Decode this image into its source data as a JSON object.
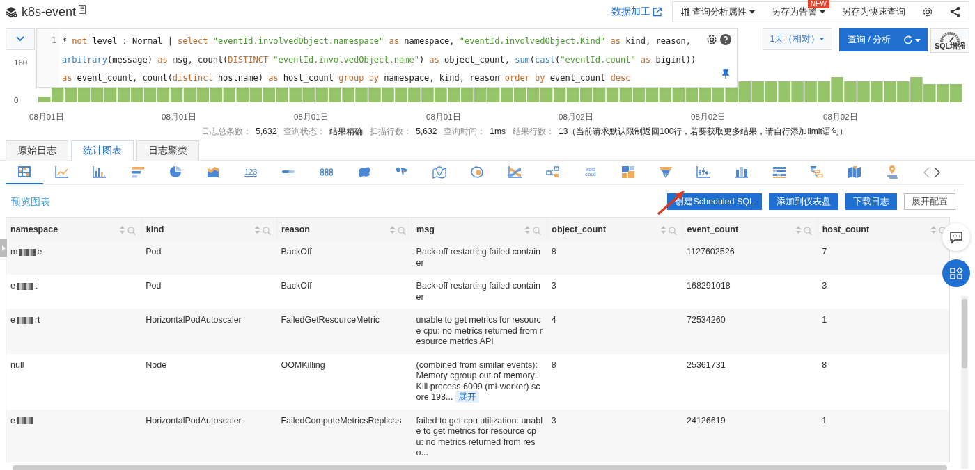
{
  "header": {
    "title": "k8s-event",
    "data_link": "数据加工",
    "toolbar": [
      {
        "kind": "sliders-dropdown",
        "label": "查询分析属性"
      },
      {
        "kind": "dropdown",
        "label": "另存为告警",
        "badge": "NEW"
      },
      {
        "kind": "plain",
        "label": "另存为快速查询"
      },
      {
        "kind": "gear"
      },
      {
        "kind": "share"
      }
    ]
  },
  "query": {
    "line_number": "1",
    "lines": [
      [
        {
          "kind": "plain",
          "text": "* "
        },
        {
          "kind": "keyword",
          "text": "not"
        },
        {
          "kind": "plain",
          "text": " level : Normal | "
        },
        {
          "kind": "keyword",
          "text": "select"
        },
        {
          "kind": "string",
          "text": " \"eventId.involvedObject.namespace\""
        },
        {
          "kind": "keyword",
          "text": " as"
        },
        {
          "kind": "plain",
          "text": " namespace, "
        },
        {
          "kind": "string",
          "text": "\"eventId.involvedObject.Kind\""
        },
        {
          "kind": "keyword",
          "text": " as"
        },
        {
          "kind": "plain",
          "text": " kind, reason,"
        }
      ],
      [
        {
          "kind": "function",
          "text": "arbitrary"
        },
        {
          "kind": "plain",
          "text": "(message) "
        },
        {
          "kind": "keyword",
          "text": "as"
        },
        {
          "kind": "plain",
          "text": " msg, count("
        },
        {
          "kind": "keyword",
          "text": "DISTINCT"
        },
        {
          "kind": "string",
          "text": " \"eventId.involvedObject.name\""
        },
        {
          "kind": "plain",
          "text": ") "
        },
        {
          "kind": "keyword",
          "text": "as"
        },
        {
          "kind": "plain",
          "text": " object_count, "
        },
        {
          "kind": "function",
          "text": "sum"
        },
        {
          "kind": "plain",
          "text": "("
        },
        {
          "kind": "function",
          "text": "cast"
        },
        {
          "kind": "plain",
          "text": "("
        },
        {
          "kind": "string",
          "text": "\"eventId.count\""
        },
        {
          "kind": "keyword",
          "text": " as"
        },
        {
          "kind": "plain",
          "text": " bigint))"
        }
      ],
      [
        {
          "kind": "keyword",
          "text": "as"
        },
        {
          "kind": "plain",
          "text": " event_count, count("
        },
        {
          "kind": "keyword",
          "text": "distinct"
        },
        {
          "kind": "plain",
          "text": " hostname) "
        },
        {
          "kind": "keyword",
          "text": "as"
        },
        {
          "kind": "plain",
          "text": " host_count "
        },
        {
          "kind": "keyword",
          "text": "group by"
        },
        {
          "kind": "plain",
          "text": " namespace, kind, reason "
        },
        {
          "kind": "keyword",
          "text": "order by"
        },
        {
          "kind": "plain",
          "text": " event_count "
        },
        {
          "kind": "keyword",
          "text": "desc"
        }
      ]
    ],
    "time_range": "1天（相对）",
    "search_button": "查询 / 分析",
    "sql_enhance": "SQL增强"
  },
  "histogram": {
    "y_labels": [
      "160",
      "0"
    ],
    "x_labels": [
      "08月01日",
      "08月01日",
      "08月01日",
      "08月01日",
      "08月02日",
      "08月02日",
      "08月02日"
    ]
  },
  "stats": [
    {
      "label": "日志总条数：",
      "value": "5,632"
    },
    {
      "label": "查询状态：",
      "value": "结果精确"
    },
    {
      "label": "扫描行数：",
      "value": "5,632"
    },
    {
      "label": "查询时间：",
      "value": "1ms"
    },
    {
      "label": "结果行数：",
      "value": "13（当前请求默认限制返回100行，若要获取更多结果，请自行添加limit语句）"
    }
  ],
  "tabs": [
    {
      "label": "原始日志",
      "selected": false
    },
    {
      "label": "统计图表",
      "selected": true
    },
    {
      "label": "日志聚类",
      "selected": false
    }
  ],
  "chart_types": [
    {
      "kind": "table",
      "selected": true
    },
    {
      "kind": "line",
      "selected": false
    },
    {
      "kind": "bar",
      "selected": false
    },
    {
      "kind": "hbar",
      "selected": false
    },
    {
      "kind": "pie",
      "selected": false
    },
    {
      "kind": "area",
      "selected": false
    },
    {
      "kind": "number",
      "label": "123",
      "selected": false
    },
    {
      "kind": "progress",
      "selected": false
    },
    {
      "kind": "dots",
      "selected": false
    },
    {
      "kind": "map",
      "selected": false
    },
    {
      "kind": "world",
      "selected": false
    },
    {
      "kind": "pin",
      "selected": false
    },
    {
      "kind": "bubble",
      "selected": false
    },
    {
      "kind": "sankey",
      "selected": false
    },
    {
      "kind": "graph",
      "selected": false
    },
    {
      "kind": "wordcloud",
      "label": "word cloud",
      "selected": false
    },
    {
      "kind": "treemap",
      "selected": false
    },
    {
      "kind": "funnel",
      "selected": false
    },
    {
      "kind": "box",
      "selected": false
    },
    {
      "kind": "columns",
      "selected": false
    },
    {
      "kind": "grid",
      "selected": false
    },
    {
      "kind": "gantt",
      "selected": false
    },
    {
      "kind": "foldmap",
      "selected": false
    },
    {
      "kind": "location",
      "selected": false
    }
  ],
  "preview": {
    "title": "预览图表",
    "actions": [
      {
        "label": "创建Scheduled SQL",
        "primary": true
      },
      {
        "label": "添加到仪表盘",
        "primary": true
      },
      {
        "label": "下载日志",
        "primary": true
      },
      {
        "label": "展开配置",
        "primary": false
      }
    ]
  },
  "table": {
    "columns": [
      "namespace",
      "kind",
      "reason",
      "msg",
      "object_count",
      "event_count",
      "host_count"
    ],
    "rows": [
      {
        "namespace": {
          "start": "m",
          "redacted": true,
          "end": "e"
        },
        "kind": "Pod",
        "reason": "BackOff",
        "msg": "Back-off restarting failed container",
        "object_count": "8",
        "event_count": "1127602526",
        "host_count": "7"
      },
      {
        "namespace": {
          "start": "e",
          "redacted": true,
          "end": "t"
        },
        "kind": "Pod",
        "reason": "BackOff",
        "msg": "Back-off restarting failed container",
        "object_count": "3",
        "event_count": "168291018",
        "host_count": "3"
      },
      {
        "namespace": {
          "start": "e",
          "redacted": true,
          "end": "rt"
        },
        "kind": "HorizontalPodAutoscaler",
        "reason": "FailedGetResourceMetric",
        "msg": "unable to get metrics for resource cpu: no metrics returned from resource metrics API",
        "object_count": "4",
        "event_count": "72534260",
        "host_count": "1"
      },
      {
        "namespace": {
          "start": "null",
          "redacted": false
        },
        "kind": "Node",
        "reason": "OOMKilling",
        "msg": "(combined from similar events): Memory cgroup out of memory: Kill process 6099 (ml-worker) score 198...",
        "expand": "展开",
        "object_count": "8",
        "event_count": "25361731",
        "host_count": "8"
      },
      {
        "namespace": {
          "start": "e",
          "redacted": true
        },
        "kind": "HorizontalPodAutoscaler",
        "reason": "FailedComputeMetricsReplicas",
        "msg": "failed to get cpu utilization: unable to get metrics for resource cpu: no metrics returned from reso...",
        "object_count": "3",
        "event_count": "24126619",
        "host_count": "1"
      }
    ]
  }
}
